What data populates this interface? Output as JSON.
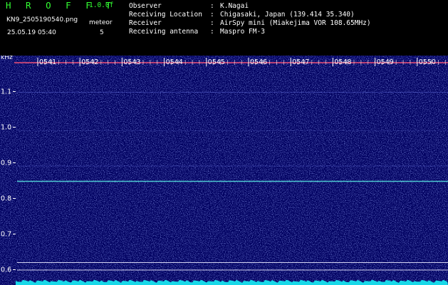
{
  "header": {
    "brand": "H R O F F T",
    "version": "1.0.0f",
    "filename": "KN9_2505190540.png",
    "meteor_label": "meteor",
    "timestamp": "25.05.19 05:40",
    "meteor_count": "5",
    "info": [
      {
        "key": "Observer",
        "sep": ":",
        "value": "K.Nagai"
      },
      {
        "key": "Receiving Location",
        "sep": ":",
        "value": "Chigasaki, Japan (139.414 35.340)"
      },
      {
        "key": "Receiver",
        "sep": ":",
        "value": "AirSpy mini (Miakejima VOR 108.65MHz)"
      },
      {
        "key": "Receiving antenna",
        "sep": ":",
        "value": "Maspro FM-3"
      }
    ]
  },
  "plot": {
    "unit_label": "kHz",
    "y_ticks": [
      "1.1",
      "1.0",
      "0.9",
      "0.8",
      "0.7",
      "0.6"
    ],
    "time_labels": [
      "0541",
      "0542",
      "0543",
      "0544",
      "0545",
      "0546",
      "0547",
      "0548",
      "0549",
      "0550"
    ],
    "colors": {
      "background": "#000060",
      "noise": "#3a4bd0",
      "carrier_line": "#55dddd",
      "time_label": "#ffffff",
      "baseline": "#18d8e8"
    }
  }
}
